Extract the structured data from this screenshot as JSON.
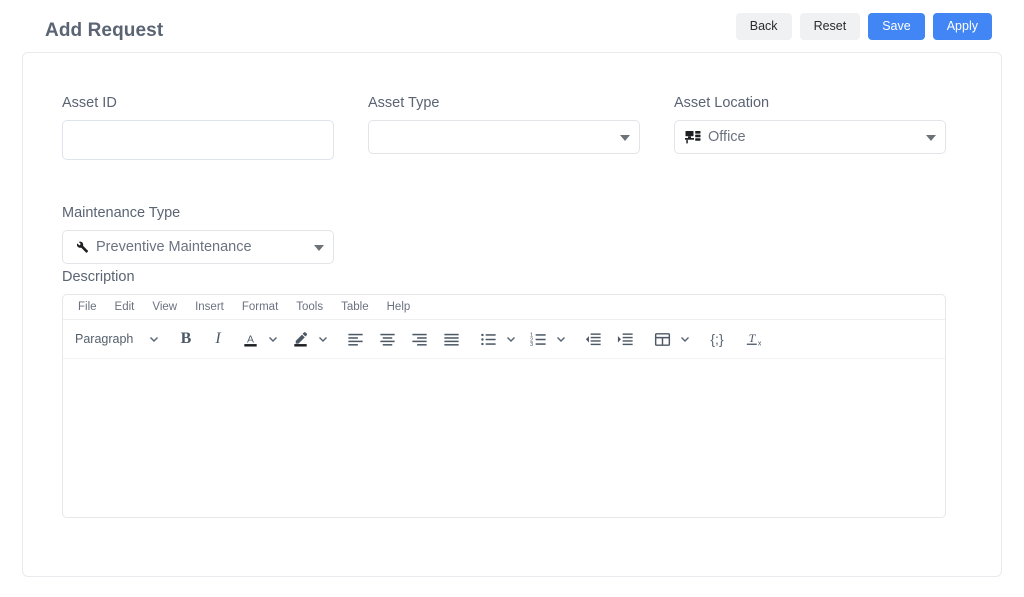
{
  "header": {
    "title": "Add Request",
    "buttons": [
      {
        "label": "Back",
        "style": "light"
      },
      {
        "label": "Reset",
        "style": "light"
      },
      {
        "label": "Save",
        "style": "primary"
      },
      {
        "label": "Apply",
        "style": "primary"
      }
    ]
  },
  "colors": {
    "primary": "#4285f4",
    "light_button": "#f0f1f3",
    "label_text": "#5a6473",
    "card_border": "#e9eaee"
  },
  "form": {
    "asset_id": {
      "label": "Asset ID",
      "value": "",
      "placeholder": ""
    },
    "asset_type": {
      "label": "Asset Type",
      "value": "",
      "icon": "",
      "arrow_icon": "caret-down-icon"
    },
    "asset_location": {
      "label": "Asset Location",
      "value": "Office",
      "icon": "desk-workstation-icon",
      "arrow_icon": "caret-down-icon"
    },
    "maintenance_type": {
      "label": "Maintenance Type",
      "value": "Preventive Maintenance",
      "icon": "wrench-icon",
      "arrow_icon": "caret-down-icon"
    },
    "description": {
      "label": "Description"
    }
  },
  "editor": {
    "menubar": [
      "File",
      "Edit",
      "View",
      "Insert",
      "Format",
      "Tools",
      "Table",
      "Help"
    ],
    "toolbar": {
      "block_format": "Paragraph",
      "items": [
        {
          "name": "block-format-select",
          "icon": "text-paragraph"
        },
        {
          "name": "block-format-chevron",
          "icon": "chevron-down-icon"
        },
        {
          "name": "bold-button",
          "icon": "bold-icon"
        },
        {
          "name": "italic-button",
          "icon": "italic-icon"
        },
        {
          "name": "text-color-button",
          "icon": "text-color-icon"
        },
        {
          "name": "text-color-chevron",
          "icon": "chevron-down-icon"
        },
        {
          "name": "background-color-button",
          "icon": "highlight-pen-icon"
        },
        {
          "name": "background-color-chevron",
          "icon": "chevron-down-icon"
        },
        {
          "name": "align-left-button",
          "icon": "align-left-icon"
        },
        {
          "name": "align-center-button",
          "icon": "align-center-icon"
        },
        {
          "name": "align-right-button",
          "icon": "align-right-icon"
        },
        {
          "name": "align-justify-button",
          "icon": "align-justify-icon"
        },
        {
          "name": "bullet-list-button",
          "icon": "bullet-list-icon"
        },
        {
          "name": "bullet-list-chevron",
          "icon": "chevron-down-icon"
        },
        {
          "name": "numbered-list-button",
          "icon": "numbered-list-icon"
        },
        {
          "name": "numbered-list-chevron",
          "icon": "chevron-down-icon"
        },
        {
          "name": "decrease-indent-button",
          "icon": "decrease-indent-icon"
        },
        {
          "name": "increase-indent-button",
          "icon": "increase-indent-icon"
        },
        {
          "name": "table-button",
          "icon": "table-icon"
        },
        {
          "name": "table-chevron",
          "icon": "chevron-down-icon"
        },
        {
          "name": "source-code-button",
          "icon": "code-braces-icon"
        },
        {
          "name": "clear-formatting-button",
          "icon": "clear-formatting-icon"
        }
      ]
    },
    "content": ""
  }
}
